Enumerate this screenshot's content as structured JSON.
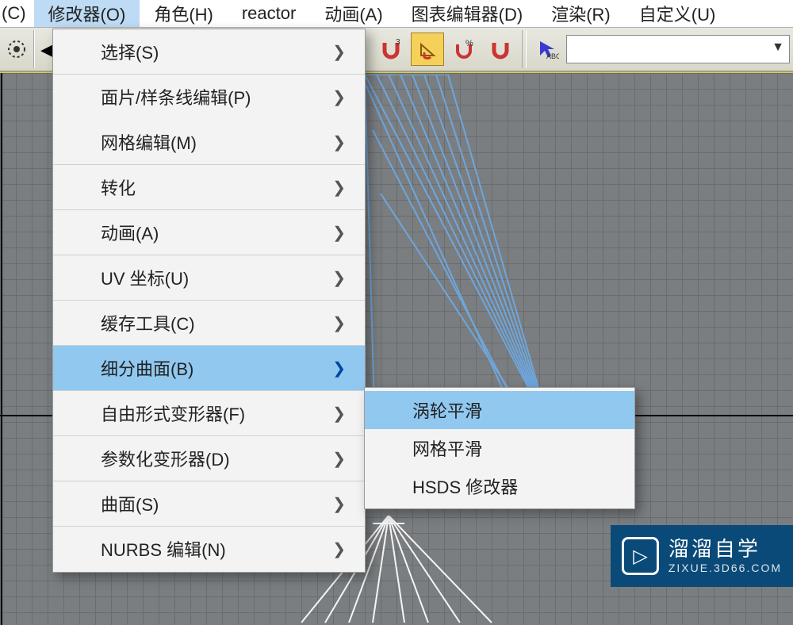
{
  "menubar": {
    "item0_partial": "(C)",
    "items": [
      "修改器(O)",
      "角色(H)",
      "reactor",
      "动画(A)",
      "图表编辑器(D)",
      "渲染(R)",
      "自定义(U)"
    ],
    "highlight_index": 0
  },
  "toolbar": {
    "filter_placeholder": ""
  },
  "dropdown": {
    "items": [
      {
        "label": "选择(S)",
        "submenu": true,
        "sep": true
      },
      {
        "label": "面片/样条线编辑(P)",
        "submenu": true
      },
      {
        "label": "网格编辑(M)",
        "submenu": true,
        "sep": true
      },
      {
        "label": "转化",
        "submenu": true,
        "sep": true
      },
      {
        "label": "动画(A)",
        "submenu": true,
        "sep": true
      },
      {
        "label": "UV 坐标(U)",
        "submenu": true,
        "sep": true
      },
      {
        "label": "缓存工具(C)",
        "submenu": true,
        "sep": true
      },
      {
        "label": "细分曲面(B)",
        "submenu": true,
        "sep": true,
        "highlight": true
      },
      {
        "label": "自由形式变形器(F)",
        "submenu": true,
        "sep": true
      },
      {
        "label": "参数化变形器(D)",
        "submenu": true,
        "sep": true
      },
      {
        "label": "曲面(S)",
        "submenu": true,
        "sep": true
      },
      {
        "label": "NURBS 编辑(N)",
        "submenu": true
      }
    ]
  },
  "submenu": {
    "items": [
      {
        "label": "涡轮平滑",
        "highlight": true
      },
      {
        "label": "网格平滑"
      },
      {
        "label": "HSDS 修改器"
      }
    ]
  },
  "watermark": {
    "main": "溜溜自学",
    "sub": "ZIXUE.3D66.COM",
    "logo_glyph": "▷"
  },
  "chevron": "❯"
}
